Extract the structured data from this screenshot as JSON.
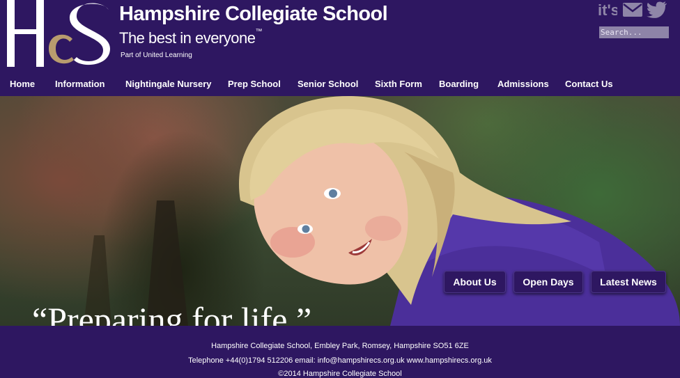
{
  "header": {
    "school_name": "Hampshire Collegiate School",
    "tagline": "The best in everyone",
    "trademark": "™",
    "part_of": "Part of United Learning",
    "logo_letters": "HcS",
    "search_placeholder": "Search...",
    "social": [
      {
        "icon": "its-learning-icon",
        "label": "it's"
      },
      {
        "icon": "email-icon"
      },
      {
        "icon": "twitter-icon"
      }
    ]
  },
  "nav": {
    "items": [
      "Home",
      "Information",
      "Nightingale Nursery",
      "Prep School",
      "Senior School",
      "Sixth Form",
      "Boarding",
      "Admissions",
      "Contact Us"
    ]
  },
  "hero": {
    "buttons": [
      "About Us",
      "Open Days",
      "Latest News"
    ],
    "quote": "“Preparing for life.”"
  },
  "footer": {
    "address": "Hampshire Collegiate School, Embley Park, Romsey, Hampshire SO51 6ZE",
    "contact": "Telephone +44(0)1794 512206 email: info@hampshirecs.org.uk www.hampshirecs.org.uk",
    "copyright": "©2014 Hampshire Collegiate School"
  },
  "colors": {
    "brand_purple": "#2e1761",
    "logo_gold": "#b89c6e",
    "search_bg": "#8e84a8",
    "social_icon": "#8f86a8"
  }
}
